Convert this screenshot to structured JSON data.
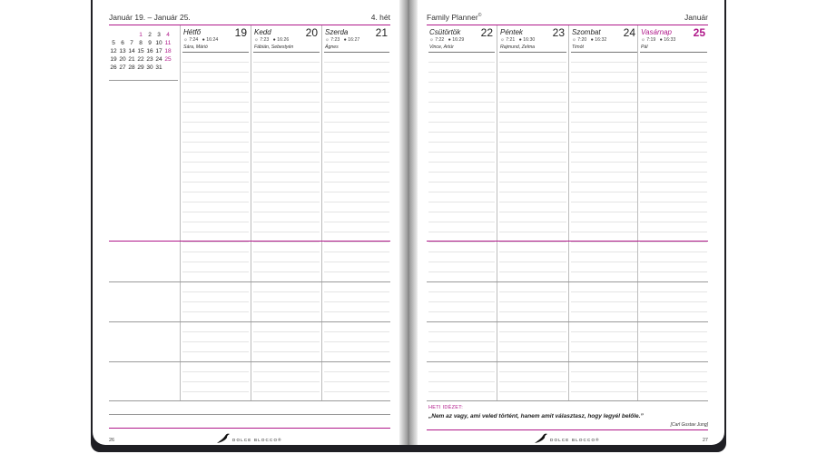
{
  "left_page": {
    "range": "Január 19. – Január 25.",
    "week": "4. hét",
    "page_number": "26",
    "calendar_rows": [
      [
        "",
        "",
        "",
        "1",
        "2",
        "3",
        "4"
      ],
      [
        "5",
        "6",
        "7",
        "8",
        "9",
        "10",
        "11"
      ],
      [
        "12",
        "13",
        "14",
        "15",
        "16",
        "17",
        "18"
      ],
      [
        "19",
        "20",
        "21",
        "22",
        "23",
        "24",
        "25"
      ],
      [
        "26",
        "27",
        "28",
        "29",
        "30",
        "31",
        ""
      ]
    ],
    "days": [
      {
        "name": "Hétfő",
        "num": "19",
        "sunrise": "7:24",
        "sunset": "16:24",
        "names": "Sára, Márió"
      },
      {
        "name": "Kedd",
        "num": "20",
        "sunrise": "7:23",
        "sunset": "16:26",
        "names": "Fábián, Sebestyén"
      },
      {
        "name": "Szerda",
        "num": "21",
        "sunrise": "7:23",
        "sunset": "16:27",
        "names": "Ágnes"
      }
    ]
  },
  "right_page": {
    "title": "Family Planner",
    "title_mark": "©",
    "month": "Január",
    "page_number": "27",
    "days": [
      {
        "name": "Csütörtök",
        "num": "22",
        "sunrise": "7:22",
        "sunset": "16:29",
        "names": "Vince, Artúr"
      },
      {
        "name": "Péntek",
        "num": "23",
        "sunrise": "7:21",
        "sunset": "16:30",
        "names": "Rajmund, Zelma"
      },
      {
        "name": "Szombat",
        "num": "24",
        "sunrise": "7:20",
        "sunset": "16:32",
        "names": "Timót"
      },
      {
        "name": "Vasárnap",
        "num": "25",
        "sunrise": "7:19",
        "sunset": "16:33",
        "names": "Pál"
      }
    ],
    "quote_title": "HETI IDÉZET:",
    "quote": "„Nem az vagy, ami veled történt, hanem amit választasz, hogy legyél belőle.”",
    "author": "[Carl Gustav Jung]"
  },
  "brand": "DOLCE BLOCCO®",
  "sun_symbols": {
    "rise": "☼",
    "set": "●"
  },
  "colors": {
    "accent": "#b0188a",
    "cover": "#1f1f24"
  }
}
